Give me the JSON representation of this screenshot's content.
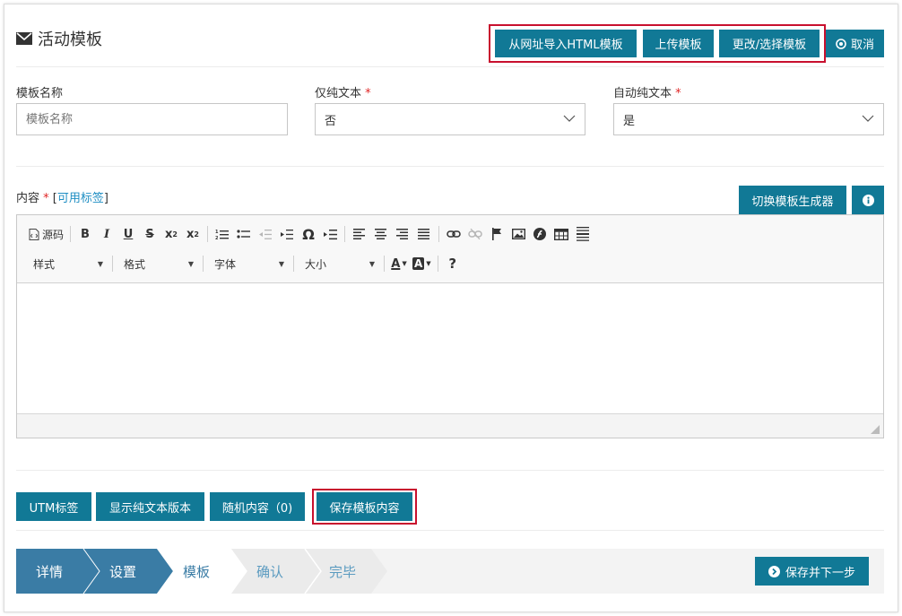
{
  "header": {
    "icon": "envelope-icon",
    "title": "活动模板",
    "import_html_label": "从网址导入HTML模板",
    "upload_label": "上传模板",
    "change_select_label": "更改/选择模板",
    "cancel_label": "取消"
  },
  "form": {
    "template_name": {
      "label": "模板名称",
      "placeholder": "模板名称",
      "value": ""
    },
    "plain_text_only": {
      "label": "仅纯文本",
      "required_mark": "*",
      "value": "否"
    },
    "auto_plain_text": {
      "label": "自动纯文本",
      "required_mark": "*",
      "value": "是"
    }
  },
  "content": {
    "label": "内容",
    "required_mark": "*",
    "bracket_open": "[",
    "available_tags_link": "可用标签",
    "bracket_close": "]",
    "switch_builder_label": "切换模板生成器",
    "info_icon": "info-icon"
  },
  "editor": {
    "source_label": "源码",
    "bold": "B",
    "italic": "I",
    "underline": "U",
    "strike": "S",
    "omega": "Ω",
    "help": "?",
    "style_combo": "样式",
    "format_combo": "格式",
    "font_combo": "字体",
    "size_combo": "大小",
    "text_color": "A",
    "bg_color": "A"
  },
  "actions": {
    "utm_label": "UTM标签",
    "show_plain_label": "显示纯文本版本",
    "random_content_label": "随机内容（0)",
    "save_template_label": "保存模板内容"
  },
  "wizard": {
    "steps": [
      "详情",
      "设置",
      "模板",
      "确认",
      "完毕"
    ],
    "active_index": 2,
    "save_next_label": "保存并下一步"
  },
  "colors": {
    "primary": "#117996",
    "highlight": "#c8102e",
    "step_done": "#3a7ca5",
    "required": "#e02424",
    "link": "#1f8ec3"
  }
}
